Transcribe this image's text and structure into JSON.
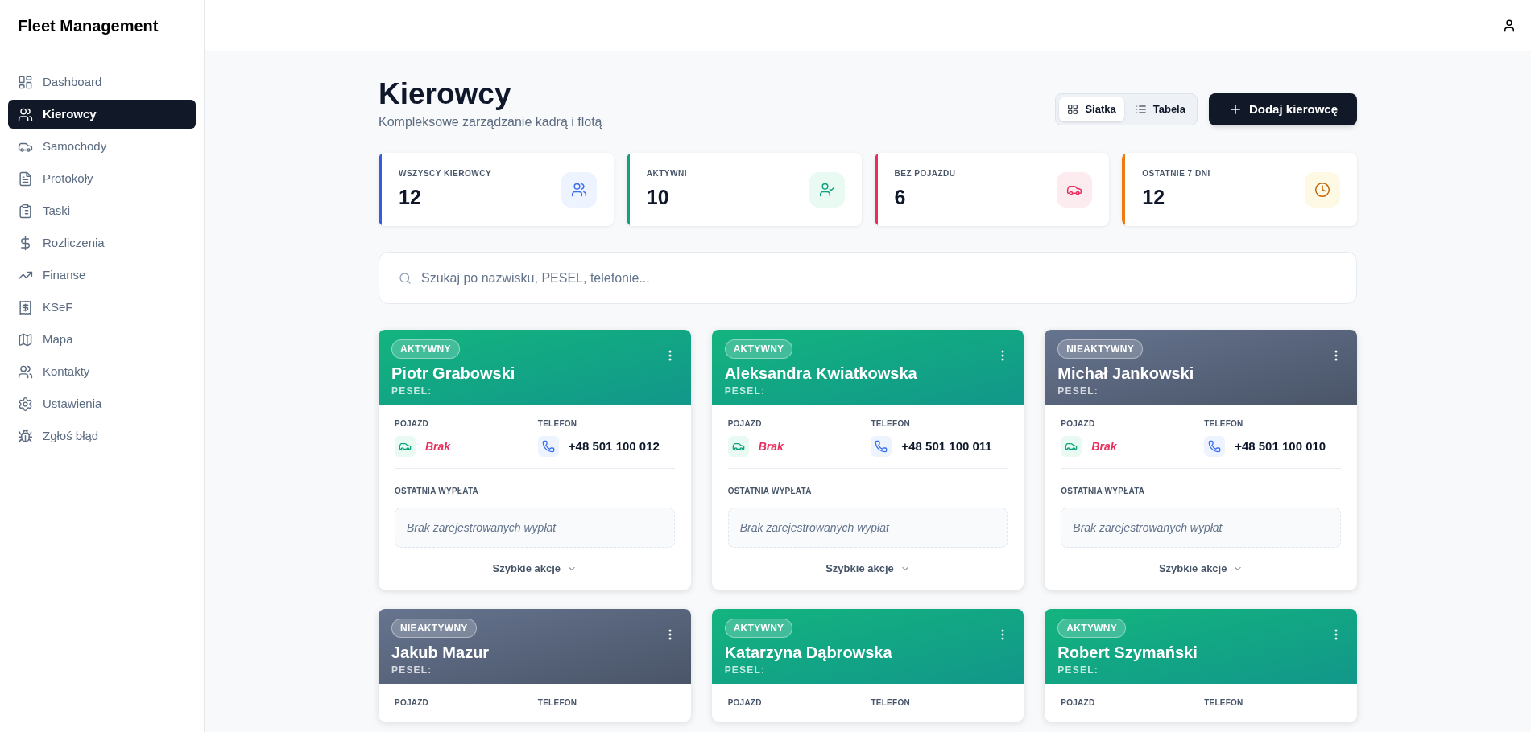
{
  "app": {
    "title": "Fleet Management"
  },
  "sidebar": {
    "items": [
      {
        "label": "Dashboard",
        "selected": false
      },
      {
        "label": "Kierowcy",
        "selected": true
      },
      {
        "label": "Samochody",
        "selected": false
      },
      {
        "label": "Protokoły",
        "selected": false
      },
      {
        "label": "Taski",
        "selected": false
      },
      {
        "label": "Rozliczenia",
        "selected": false
      },
      {
        "label": "Finanse",
        "selected": false
      },
      {
        "label": "KSeF",
        "selected": false
      },
      {
        "label": "Mapa",
        "selected": false
      },
      {
        "label": "Kontakty",
        "selected": false
      },
      {
        "label": "Ustawienia",
        "selected": false
      },
      {
        "label": "Zgłoś błąd",
        "selected": false
      }
    ]
  },
  "page": {
    "title": "Kierowcy",
    "subtitle": "Kompleksowe zarządzanie kadrą i flotą"
  },
  "view_toggle": [
    {
      "label": "Siatka",
      "selected": true
    },
    {
      "label": "Tabela",
      "selected": false
    }
  ],
  "add_button": {
    "label": "Dodaj kierowcę"
  },
  "stats": [
    {
      "label": "WSZYSCY KIEROWCY",
      "value": "12",
      "color": "#3b5bdb"
    },
    {
      "label": "AKTYWNI",
      "value": "10",
      "color": "#10a37f"
    },
    {
      "label": "BEZ POJAZDU",
      "value": "6",
      "color": "#e8305f"
    },
    {
      "label": "OSTATNIE 7 DNI",
      "value": "12",
      "color": "#f07a12"
    }
  ],
  "search": {
    "placeholder": "Szukaj po nazwisku, PESEL, telefonie..."
  },
  "drivers": [
    {
      "kind": "active",
      "status_label": "AKTYWNY",
      "name": "Piotr Grabowski",
      "pesel_label": "PESEL:",
      "vehicle_label": "POJAZD",
      "vehicle": "Brak",
      "phone_label": "TELEFON",
      "phone": "+48 501 100 012",
      "payout_label": "OSTATNIA WYPŁATA",
      "payout": "Brak zarejestrowanych wypłat",
      "actions": "Szybkie akcje"
    },
    {
      "kind": "active",
      "status_label": "AKTYWNY",
      "name": "Aleksandra Kwiatkowska",
      "pesel_label": "PESEL:",
      "vehicle_label": "POJAZD",
      "vehicle": "Brak",
      "phone_label": "TELEFON",
      "phone": "+48 501 100 011",
      "payout_label": "OSTATNIA WYPŁATA",
      "payout": "Brak zarejestrowanych wypłat",
      "actions": "Szybkie akcje"
    },
    {
      "kind": "inactive",
      "status_label": "NIEAKTYWNY",
      "name": "Michał Jankowski",
      "pesel_label": "PESEL:",
      "vehicle_label": "POJAZD",
      "vehicle": "Brak",
      "phone_label": "TELEFON",
      "phone": "+48 501 100 010",
      "payout_label": "OSTATNIA WYPŁATA",
      "payout": "Brak zarejestrowanych wypłat",
      "actions": "Szybkie akcje"
    },
    {
      "kind": "inactive",
      "status_label": "NIEAKTYWNY",
      "name": "Jakub Mazur",
      "pesel_label": "PESEL:",
      "vehicle_label": "POJAZD",
      "phone_label": "TELEFON"
    },
    {
      "kind": "active",
      "status_label": "AKTYWNY",
      "name": "Katarzyna Dąbrowska",
      "pesel_label": "PESEL:",
      "vehicle_label": "POJAZD",
      "phone_label": "TELEFON"
    },
    {
      "kind": "active",
      "status_label": "AKTYWNY",
      "name": "Robert Szymański",
      "pesel_label": "PESEL:",
      "vehicle_label": "POJAZD",
      "phone_label": "TELEFON"
    }
  ]
}
